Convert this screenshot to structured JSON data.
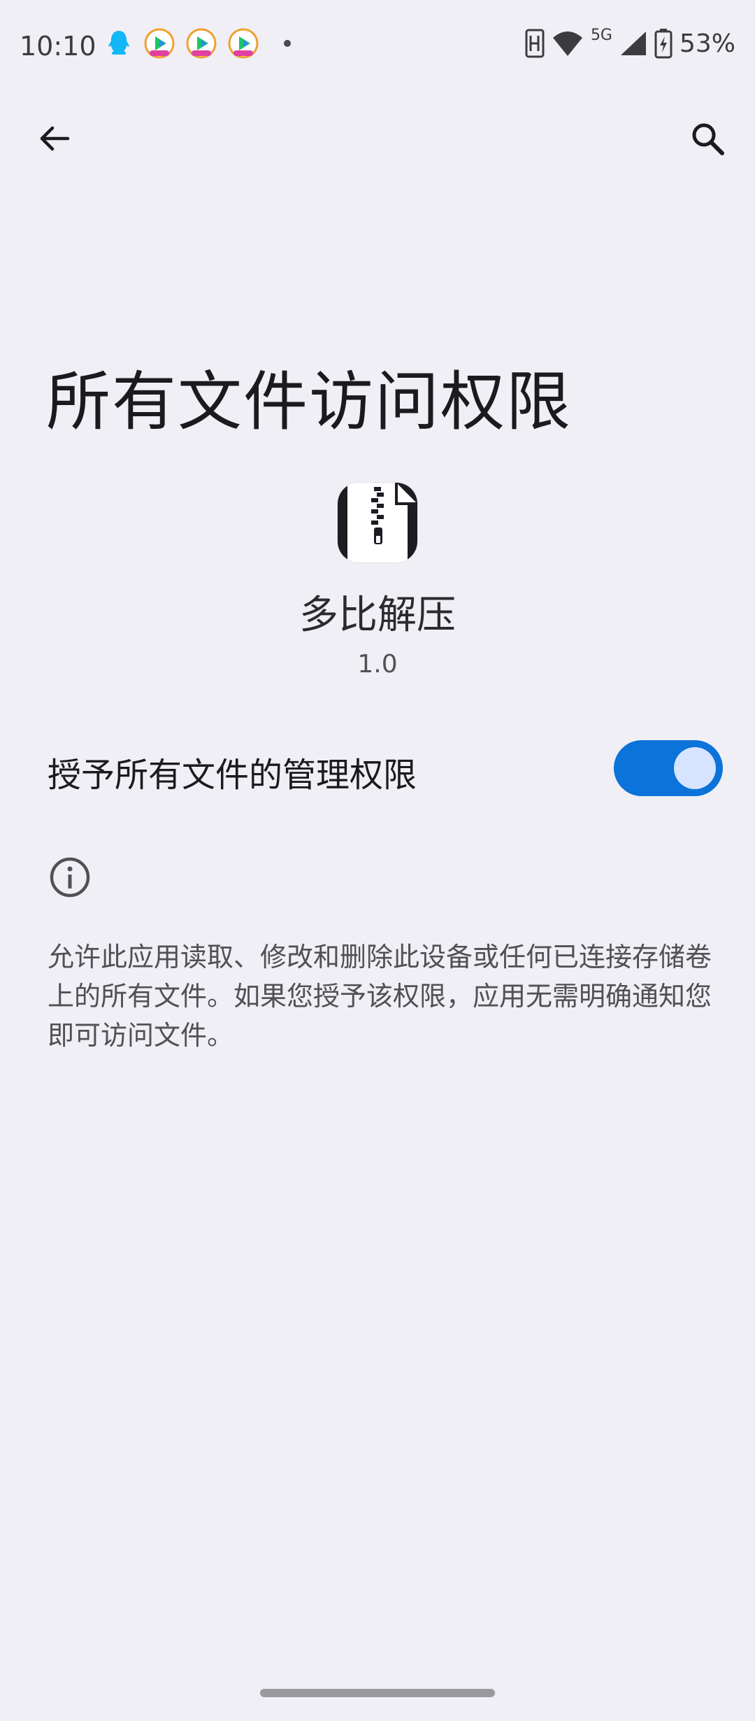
{
  "status_bar": {
    "time": "10:10",
    "network": "5G",
    "battery": "53%"
  },
  "app_bar": {
    "back_icon": "arrow-back-icon",
    "search_icon": "search-icon"
  },
  "page": {
    "title": "所有文件访问权限"
  },
  "app": {
    "name": "多比解压",
    "version": "1.0",
    "icon": "zip-file-icon"
  },
  "permission": {
    "label": "授予所有文件的管理权限",
    "enabled": true
  },
  "info": {
    "icon": "info-icon",
    "description": "允许此应用读取、修改和删除此设备或任何已连接存储卷上的所有文件。如果您授予该权限，应用无需明确通知您即可访问文件。"
  },
  "colors": {
    "background": "#f0eff5",
    "switch_track": "#0b73d9",
    "switch_thumb": "#d6e4ff"
  }
}
